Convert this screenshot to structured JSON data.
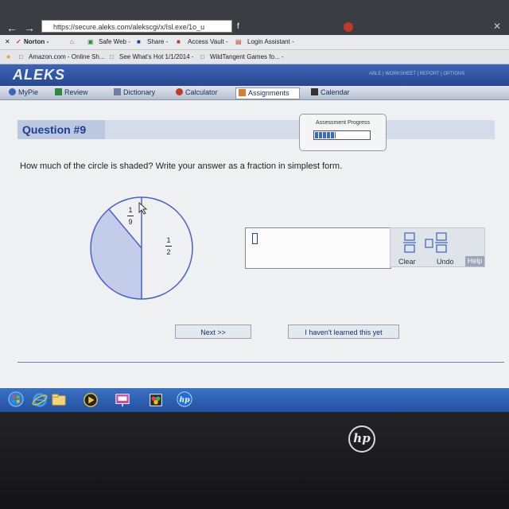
{
  "browser": {
    "url": "https://secure.aleks.com/alekscgi/x/Isl.exe/1o_u",
    "tab_glyph": "f",
    "toolbar": [
      "Norton -",
      "Safe Web -",
      "Share -",
      "Access Vault -",
      "Login Assistant -"
    ],
    "favorites": [
      "Amazon.com - Online Sh...",
      "See What's Hot 1/1/2014 -",
      "WildTangent Games fo... -"
    ]
  },
  "aleks": {
    "logo": "ALEKS",
    "top_links": "ABLE | WORKSHEET | REPORT | OPTIONS",
    "menu": [
      "MyPie",
      "Review",
      "Dictionary",
      "Calculator",
      "Assignments",
      "Calendar"
    ]
  },
  "question": {
    "label": "Question #9",
    "text": "How much of the circle is shaded? Write your answer as a fraction in simplest form."
  },
  "progress": {
    "title": "Assessment Progress",
    "fraction": 0.38
  },
  "pie": {
    "label_top": {
      "num": "1",
      "den": "9"
    },
    "label_right": {
      "num": "1",
      "den": "2"
    },
    "shaded_color": "#c3cde9",
    "outline_color": "#4a5fcf"
  },
  "answer": {
    "value": ""
  },
  "tools": {
    "clear": "Clear",
    "undo": "Undo",
    "help": "Help"
  },
  "buttons": {
    "next": "Next >>",
    "not_learned": "I haven't learned this yet"
  },
  "hp_logo": "hp"
}
